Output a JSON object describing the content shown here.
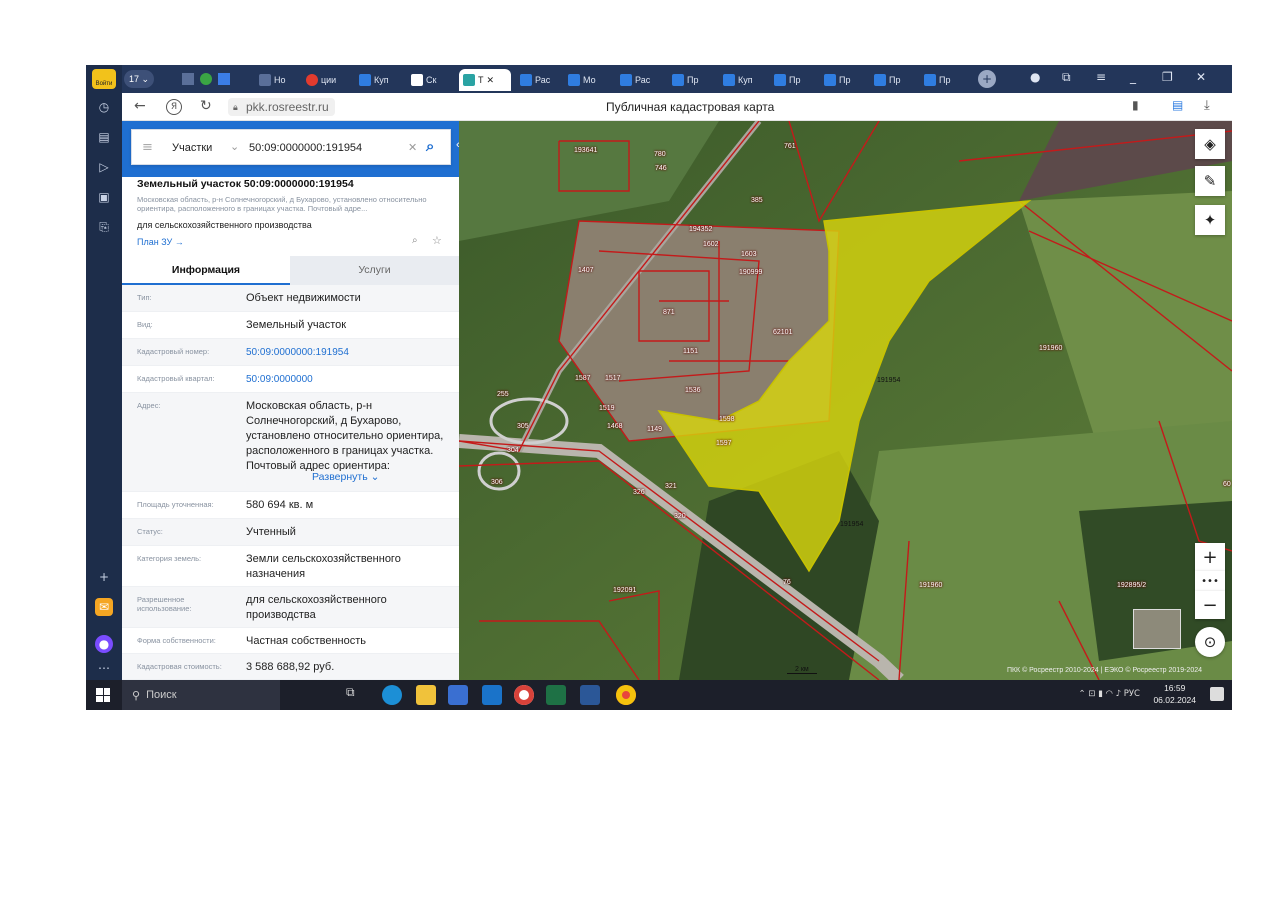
{
  "browser": {
    "user_badge": "Войти",
    "tab_count": "17",
    "tabs": [
      {
        "label": "Но",
        "color": "#4b6fb3"
      },
      {
        "label": "ции",
        "color": "#e23b2e"
      },
      {
        "label": "Куп",
        "color": "#2f7de1"
      },
      {
        "label": "Ск",
        "color": "#ffffff"
      },
      {
        "label": "Т",
        "color": "#2aa3a3",
        "active": true
      },
      {
        "label": "Рас",
        "color": "#2f7de1"
      },
      {
        "label": "Мо",
        "color": "#2f7de1"
      },
      {
        "label": "Рас",
        "color": "#2f7de1"
      },
      {
        "label": "Пр",
        "color": "#2f7de1"
      },
      {
        "label": "Куп",
        "color": "#2f7de1"
      },
      {
        "label": "Пр",
        "color": "#2f7de1"
      },
      {
        "label": "Пр",
        "color": "#2f7de1"
      },
      {
        "label": "Пр",
        "color": "#2f7de1"
      },
      {
        "label": "Пр",
        "color": "#2f7de1"
      }
    ],
    "url": "pkk.rosreestr.ru",
    "page_title": "Публичная кадастровая карта"
  },
  "search": {
    "type": "Участки",
    "query": "50:09:0000000:191954"
  },
  "parcel": {
    "title": "Земельный участок 50:09:0000000:191954",
    "address_short": "Московская область, р-н Солнечногорский, д Бухарово, установлено относительно ориентира, расположенного в границах участка. Почтовый адре...",
    "use": "для сельскохозяйственного производства",
    "plan_link": "План ЗУ →"
  },
  "tabs": {
    "info": "Информация",
    "services": "Услуги"
  },
  "fields": {
    "type_k": "Тип:",
    "type_v": "Объект недвижимости",
    "kind_k": "Вид:",
    "kind_v": "Земельный участок",
    "cadnum_k": "Кадастровый номер:",
    "cadnum_v": "50:09:0000000:191954",
    "quarter_k": "Кадастровый квартал:",
    "quarter_v": "50:09:0000000",
    "addr_k": "Адрес:",
    "addr_v": "Московская область, р-н Солнечногорский, д Бухарово, установлено относительно ориентира, расположенного в границах участка. Почтовый адрес ориентира:",
    "expand": "Развернуть",
    "area_k": "Площадь уточненная:",
    "area_v": "580 694 кв. м",
    "status_k": "Статус:",
    "status_v": "Учтенный",
    "cat_k": "Категория земель:",
    "cat_v": "Земли сельскохозяйственного назначения",
    "perm_k": "Разрешенное использование:",
    "perm_v": "для сельскохозяйственного производства",
    "own_k": "Форма собственности:",
    "own_v": "Частная собственность",
    "cost_k": "Кадастровая стоимость:",
    "cost_v": "3 588 688,92 руб."
  },
  "map": {
    "labels": [
      "193641",
      "780",
      "746",
      "761",
      "385",
      "1407",
      "194352",
      "1602",
      "1603",
      "190999",
      "871",
      "1151",
      "191960",
      "191954",
      "255",
      "305",
      "304",
      "306",
      "320",
      "321",
      "326",
      "1597",
      "191954",
      "192091",
      "76",
      "191960",
      "192895/2",
      "62101",
      "1519",
      "1468",
      "1149",
      "1587",
      "1517",
      "1536",
      "1598",
      "60"
    ],
    "scale": "2 км",
    "attribution": "ПКК © Росреестр 2010-2024 | ЕЭКО © Росреестр 2019-2024"
  },
  "taskbar": {
    "search": "Поиск",
    "lang": "РУС",
    "time": "16:59",
    "date": "06.02.2024"
  }
}
